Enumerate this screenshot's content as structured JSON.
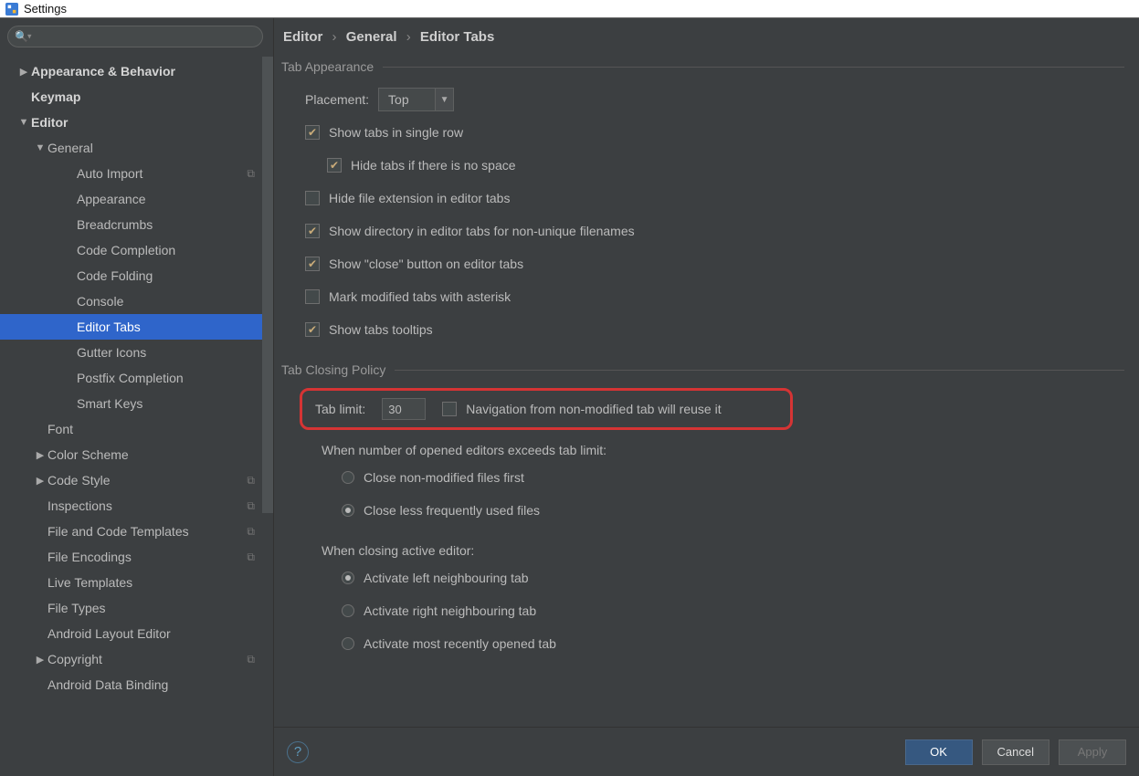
{
  "window": {
    "title": "Settings"
  },
  "search": {
    "placeholder": ""
  },
  "breadcrumb": {
    "p1": "Editor",
    "p2": "General",
    "p3": "Editor Tabs"
  },
  "tree": [
    {
      "label": "Appearance & Behavior",
      "level": 0,
      "bold": true,
      "exp": "▶"
    },
    {
      "label": "Keymap",
      "level": 0,
      "bold": true,
      "exp": ""
    },
    {
      "label": "Editor",
      "level": 0,
      "bold": true,
      "exp": "▼"
    },
    {
      "label": "General",
      "level": 1,
      "exp": "▼"
    },
    {
      "label": "Auto Import",
      "level": 2,
      "badge": true
    },
    {
      "label": "Appearance",
      "level": 2
    },
    {
      "label": "Breadcrumbs",
      "level": 2
    },
    {
      "label": "Code Completion",
      "level": 2
    },
    {
      "label": "Code Folding",
      "level": 2
    },
    {
      "label": "Console",
      "level": 2
    },
    {
      "label": "Editor Tabs",
      "level": 2,
      "selected": true
    },
    {
      "label": "Gutter Icons",
      "level": 2
    },
    {
      "label": "Postfix Completion",
      "level": 2
    },
    {
      "label": "Smart Keys",
      "level": 2
    },
    {
      "label": "Font",
      "level": 1,
      "exp": ""
    },
    {
      "label": "Color Scheme",
      "level": 1,
      "exp": "▶"
    },
    {
      "label": "Code Style",
      "level": 1,
      "exp": "▶",
      "badge": true
    },
    {
      "label": "Inspections",
      "level": 1,
      "badge": true
    },
    {
      "label": "File and Code Templates",
      "level": 1,
      "badge": true
    },
    {
      "label": "File Encodings",
      "level": 1,
      "badge": true
    },
    {
      "label": "Live Templates",
      "level": 1
    },
    {
      "label": "File Types",
      "level": 1
    },
    {
      "label": "Android Layout Editor",
      "level": 1
    },
    {
      "label": "Copyright",
      "level": 1,
      "exp": "▶",
      "badge": true
    },
    {
      "label": "Android Data Binding",
      "level": 1
    }
  ],
  "section_appearance": {
    "title": "Tab Appearance",
    "placement_label": "Placement:",
    "placement_value": "Top",
    "opts": [
      {
        "checked": true,
        "label": "Show tabs in single row"
      },
      {
        "checked": true,
        "label": "Hide tabs if there is no space",
        "indent": true
      },
      {
        "checked": false,
        "label": "Hide file extension in editor tabs"
      },
      {
        "checked": true,
        "label": "Show directory in editor tabs for non-unique filenames"
      },
      {
        "checked": true,
        "label": "Show \"close\" button on editor tabs"
      },
      {
        "checked": false,
        "label": "Mark modified tabs with asterisk"
      },
      {
        "checked": true,
        "label": "Show tabs tooltips"
      }
    ]
  },
  "section_closing": {
    "title": "Tab Closing Policy",
    "tab_limit_label": "Tab limit:",
    "tab_limit_value": "30",
    "reuse_label": "Navigation from non-modified tab will reuse it",
    "exceed_label": "When number of opened editors exceeds tab limit:",
    "exceed_opts": [
      {
        "checked": false,
        "label": "Close non-modified files first"
      },
      {
        "checked": true,
        "label": "Close less frequently used files"
      }
    ],
    "close_active_label": "When closing active editor:",
    "close_active_opts": [
      {
        "checked": true,
        "label": "Activate left neighbouring tab"
      },
      {
        "checked": false,
        "label": "Activate right neighbouring tab"
      },
      {
        "checked": false,
        "label": "Activate most recently opened tab"
      }
    ]
  },
  "footer": {
    "ok": "OK",
    "cancel": "Cancel",
    "apply": "Apply"
  }
}
